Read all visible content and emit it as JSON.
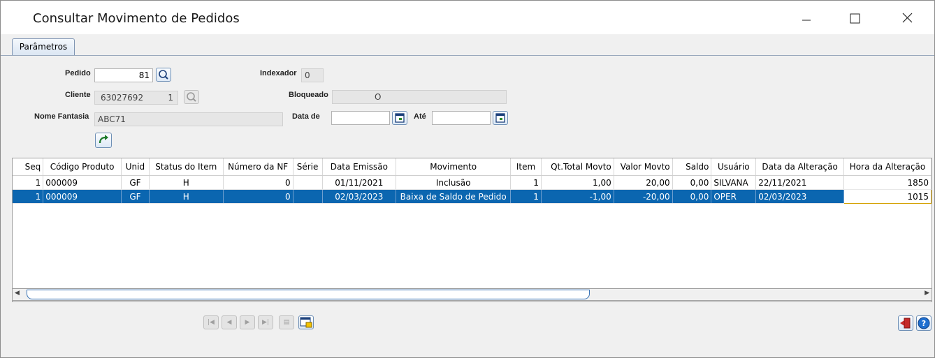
{
  "window": {
    "title": "Consultar Movimento de Pedidos"
  },
  "tabs": [
    {
      "label": "Parâmetros"
    }
  ],
  "form": {
    "pedido_label": "Pedido",
    "pedido_value": "81",
    "indexador_label": "Indexador",
    "indexador_value": "0",
    "cliente_label": "Cliente",
    "cliente_code": "63027692",
    "cliente_seq": "1",
    "bloqueado_label": "Bloqueado",
    "bloqueado_value": "O",
    "nome_fantasia_label": "Nome Fantasia",
    "nome_fantasia_value": "ABC71",
    "data_de_label": "Data de",
    "data_de_value": "",
    "ate_label": "Até",
    "ate_value": ""
  },
  "grid": {
    "columns": [
      "Seq",
      "Código Produto",
      "Unid",
      "Status do Item",
      "Número da NF",
      "Série",
      "Data Emissão",
      "Movimento",
      "Item",
      "Qt.Total Movto",
      "Valor Movto",
      "Saldo",
      "Usuário",
      "Data da Alteração",
      "Hora da Alteração"
    ],
    "rows": [
      [
        "1",
        "000009",
        "GF",
        "H",
        "0",
        "",
        "01/11/2021",
        "Inclusão",
        "1",
        "1,00",
        "20,00",
        "0,00",
        "SILVANA",
        "22/11/2021",
        "1850"
      ],
      [
        "1",
        "000009",
        "GF",
        "H",
        "0",
        "",
        "02/03/2023",
        "Baixa de Saldo de Pedido",
        "1",
        "-1,00",
        "-20,00",
        "0,00",
        "OPER",
        "02/03/2023",
        "1015"
      ]
    ],
    "selected_row": 1
  },
  "icons": {
    "minimize": "minimize-icon",
    "maximize": "maximize-icon",
    "close": "close-icon",
    "search": "search-icon",
    "refresh": "refresh-arrow-icon",
    "calendar": "calendar-icon",
    "exit": "exit-door-icon",
    "help": "help-icon"
  },
  "colors": {
    "selection": "#0b66b0",
    "accent": "#3a74b7"
  }
}
